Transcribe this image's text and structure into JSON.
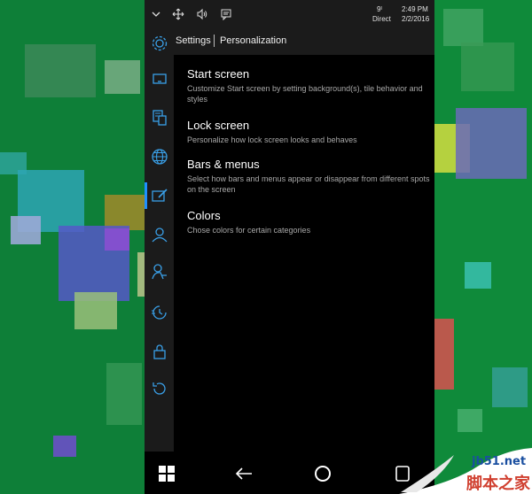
{
  "status_bar": {
    "carrier": "Direct",
    "signal": "9ᴵ",
    "time": "2:49 PM",
    "date": "2/2/2016",
    "icons": [
      "chevron-down-icon",
      "move-icon",
      "volume-icon",
      "message-icon"
    ]
  },
  "header": {
    "app": "Settings",
    "page": "Personalization"
  },
  "rail": {
    "icons": [
      "gear-icon",
      "tablet-icon",
      "devices-icon",
      "globe-icon",
      "personalization-icon",
      "person-icon",
      "ease-of-access-icon",
      "clock-icon",
      "lock-icon",
      "update-icon"
    ],
    "selected_index": 4
  },
  "items": [
    {
      "title": "Start screen",
      "desc": "Customize Start screen by setting background(s), tile behavior and styles"
    },
    {
      "title": "Lock screen",
      "desc": "Personalize how lock screen looks and behaves"
    },
    {
      "title": "Bars & menus",
      "desc": "Select how bars and menus appear or disappear from different spots on the screen"
    },
    {
      "title": "Colors",
      "desc": "Chose colors for certain categories"
    }
  ],
  "navbar": {
    "icons": [
      "windows-icon",
      "back-icon",
      "home-circle-icon",
      "task-view-icon"
    ]
  },
  "watermark": {
    "line1": "jb51.net",
    "line2": "脚本之家"
  },
  "colors": {
    "accent": "#1e90ff",
    "background": "#0f8a3a"
  }
}
